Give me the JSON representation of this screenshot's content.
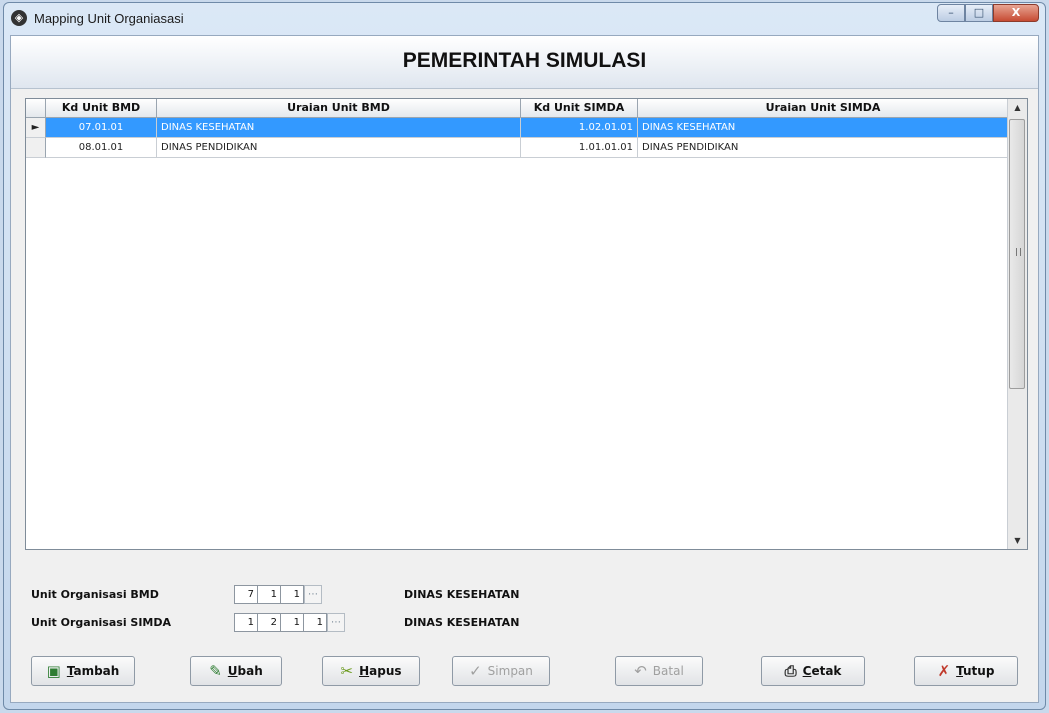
{
  "window": {
    "title": "Mapping Unit Organiasasi",
    "controls": [
      "–",
      "□",
      "X"
    ]
  },
  "header": {
    "title": "PEMERINTAH SIMULASI"
  },
  "grid": {
    "columns": [
      "Kd Unit BMD",
      "Uraian Unit BMD",
      "Kd Unit SIMDA",
      "Uraian Unit SIMDA"
    ],
    "indicator": "►",
    "rows": [
      {
        "kd_bmd": "07.01.01",
        "uraian_bmd": "DINAS KESEHATAN",
        "kd_simda": "1.02.01.01",
        "uraian_simda": "DINAS KESEHATAN",
        "selected": true
      },
      {
        "kd_bmd": "08.01.01",
        "uraian_bmd": "DINAS PENDIDIKAN",
        "kd_simda": "1.01.01.01",
        "uraian_simda": "DINAS PENDIDIKAN",
        "selected": false
      }
    ],
    "scroll_up": "▲",
    "scroll_down": "▼"
  },
  "form": {
    "bmd": {
      "label": "Unit Organisasi BMD",
      "codes": [
        "7",
        "1",
        "1"
      ],
      "name": "DINAS KESEHATAN"
    },
    "simda": {
      "label": "Unit Organisasi SIMDA",
      "codes": [
        "1",
        "2",
        "1",
        "1"
      ],
      "name": "DINAS KESEHATAN"
    }
  },
  "buttons": {
    "tambah": {
      "hot": "T",
      "rest": "ambah",
      "icon": "add-icon"
    },
    "ubah": {
      "hot": "U",
      "rest": "bah",
      "icon": "edit-icon"
    },
    "hapus": {
      "hot": "H",
      "rest": "apus",
      "icon": "delete-icon"
    },
    "simpan": {
      "label": "Simpan",
      "icon": "check-icon"
    },
    "batal": {
      "label": "Batal",
      "icon": "undo-icon"
    },
    "cetak": {
      "hot": "C",
      "rest": "etak",
      "icon": "printer-icon"
    },
    "tutup": {
      "hot": "T",
      "rest": "utup",
      "icon": "close-brush-icon"
    }
  },
  "colors": {
    "selection": "#3399ff",
    "title_bar": "#c3d6ec"
  }
}
